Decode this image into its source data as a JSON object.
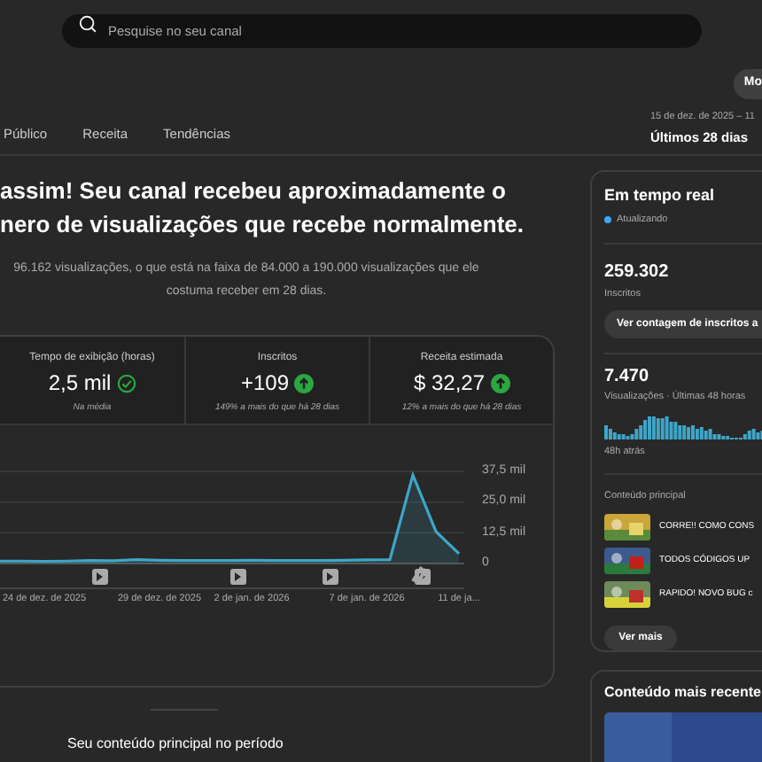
{
  "search": {
    "placeholder": "Pesquise no seu canal"
  },
  "header_button": {
    "label": "Mo"
  },
  "date_range": {
    "dates": "15 de dez. de 2025 – 11",
    "period": "Últimos 28 dias"
  },
  "tabs": [
    {
      "label": "Público",
      "selected": false
    },
    {
      "label": "Receita",
      "selected": false
    },
    {
      "label": "Tendências",
      "selected": false
    }
  ],
  "headline": [
    "assim! Seu canal recebeu aproximadamente o",
    "nero de visualizações que recebe normalmente."
  ],
  "summary": "96.162 visualizações, o que está na faixa de 84.000 a 190.000 visualizações que ele costuma receber em 28 dias.",
  "metrics": [
    {
      "label": "Tempo de exibição (horas)",
      "value": "2,5 mil",
      "kind": "check",
      "note": "Na média"
    },
    {
      "label": "Inscritos",
      "value": "+109",
      "kind": "up",
      "note": "149% a mais do que há 28 dias"
    },
    {
      "label": "Receita estimada",
      "value": "$ 32,27",
      "kind": "up",
      "note": "12% a mais do que há 28 dias"
    }
  ],
  "chart_data": {
    "type": "area",
    "categories": [
      null,
      null,
      "24 de dez. de 2025",
      null,
      null,
      null,
      null,
      "29 de dez. de 2025",
      null,
      null,
      null,
      "2 de jan. de 2026",
      null,
      null,
      null,
      null,
      "7 de jan. de 2026",
      null,
      null,
      null,
      "11 de ja..."
    ],
    "series": [
      {
        "color": "#3ea6c8",
        "values": [
          1.0,
          1.0,
          0.9,
          1.0,
          1.2,
          1.1,
          1.6,
          1.3,
          1.2,
          1.2,
          1.2,
          1.3,
          1.2,
          1.2,
          1.2,
          1.3,
          1.5,
          1.6,
          36.0,
          13.0,
          4.0
        ]
      }
    ],
    "ylim": [
      0,
      37.5
    ],
    "yticks": [
      {
        "value": 0,
        "label": "0"
      },
      {
        "value": 12.5,
        "label": "12,5 mil"
      },
      {
        "value": 25,
        "label": "25,0 mil"
      },
      {
        "value": 37.5,
        "label": "37,5 mil"
      }
    ]
  },
  "section_title": "Seu conteúdo principal no período",
  "realtime": {
    "title": "Em tempo real",
    "status": "Atualizando",
    "subscribers": "259.302",
    "subscribers_label": "Inscritos",
    "count_button": "Ver contagem de inscritos a",
    "views": "7.470",
    "views_label": "Visualizações · Últimas 48 horas",
    "since": "48h atrás",
    "top_title": "Conteúdo principal",
    "top_items": [
      {
        "title": "CORRE!! COMO CONS"
      },
      {
        "title": "TODOS CÓDIGOS UP"
      },
      {
        "title": "RAPIDO! NOVO BUG c"
      }
    ],
    "more_button": "Ver mais"
  },
  "latest": {
    "title": "Conteúdo mais recente"
  }
}
